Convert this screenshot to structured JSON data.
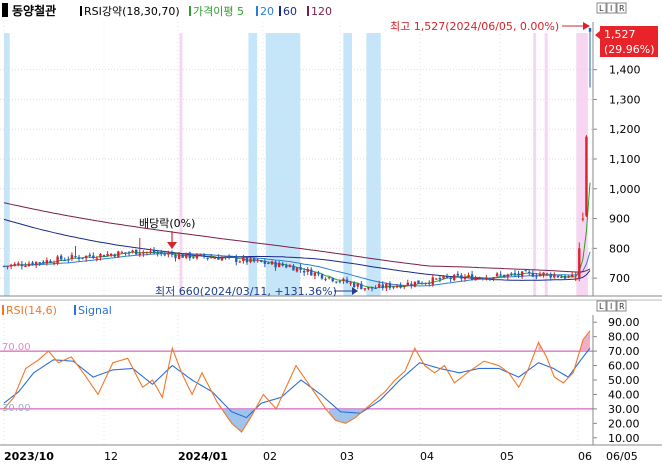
{
  "header": {
    "stock_name": "동양철관",
    "legend": [
      {
        "label": "RSI강약(18,30,70)",
        "color": "#000000",
        "marker": "#000000"
      },
      {
        "label": "가격이평 5",
        "color": "#2e9e2e",
        "marker": "#2e9e2e"
      },
      {
        "label": "20",
        "color": "#2a7fd4",
        "marker": "#2a7fd4"
      },
      {
        "label": "60",
        "color": "#1a2a8a",
        "marker": "#1a2a8a"
      },
      {
        "label": "120",
        "color": "#7a1f4a",
        "marker": "#7a1f4a"
      }
    ],
    "panel_buttons": [
      "L",
      "I",
      "R"
    ]
  },
  "annotations": {
    "high": "최고 1,527(2024/06/05, 0.00%)",
    "low": "최저 660(2024/03/11, +131.36%)",
    "dividend": "배당락(0%)",
    "current_price": "1,527",
    "current_change": "(29.96%)"
  },
  "lower_header": {
    "rsi_label": "RSI(14,6)",
    "signal_label": "Signal",
    "level_70": "70.00",
    "level_30": "30.00"
  },
  "colors": {
    "up": "#d8232a",
    "down": "#1f5fbf",
    "rsi": "#f07828",
    "signal": "#2d6fd6",
    "band_blue": "#c5e5f8",
    "band_pink": "#f8d5f2",
    "level_line": "#d040b0",
    "price_label_bg": "#e8242a"
  },
  "chart_data": [
    {
      "type": "candlestick",
      "title": "동양철관",
      "x_labels": [
        "2023/10",
        "12",
        "2024/01",
        "02",
        "03",
        "04",
        "05",
        "06"
      ],
      "ylim": [
        640,
        1560
      ],
      "y_ticks": [
        700,
        800,
        900,
        1000,
        1100,
        1200,
        1300,
        1400,
        1527
      ],
      "close_series_key": [
        [
          "2023/10 start",
          740
        ],
        [
          "2023/11 mid",
          770
        ],
        [
          "2023/12 early",
          790
        ],
        [
          "2023/12 dividend",
          775
        ],
        [
          "2024/01",
          770
        ],
        [
          "2024/02",
          740
        ],
        [
          "2024/03/11",
          665
        ],
        [
          "2024/04",
          700
        ],
        [
          "2024/05",
          715
        ],
        [
          "2024/05 late",
          700
        ],
        [
          "2024/06/03",
          900
        ],
        [
          "2024/06/04",
          1175
        ],
        [
          "2024/06/05",
          1527
        ]
      ],
      "moving_averages": [
        {
          "name": "5",
          "color": "#2e9e2e"
        },
        {
          "name": "20",
          "color": "#2a7fd4"
        },
        {
          "name": "60",
          "color": "#1a2a8a"
        },
        {
          "name": "120",
          "color": "#7a1f4a"
        }
      ],
      "high": {
        "value": 1527,
        "date": "2024/06/05"
      },
      "low": {
        "value": 660,
        "date": "2024/03/11"
      }
    },
    {
      "type": "line",
      "series": [
        {
          "name": "RSI(14,6)",
          "color": "#f07828"
        },
        {
          "name": "Signal",
          "color": "#2d6fd6"
        }
      ],
      "ylim": [
        5,
        95
      ],
      "y_ticks": [
        10,
        20,
        30,
        40,
        50,
        60,
        70,
        80,
        90
      ],
      "y_tick_labels": [
        "10.00",
        "20.00",
        "30.00",
        "40.00",
        "50.00",
        "60.00",
        "70.00",
        "80.00",
        "90.00"
      ],
      "levels": [
        70,
        30
      ],
      "x_labels": [
        "2023/10",
        "12",
        "2024/01",
        "02",
        "03",
        "04",
        "05",
        "06"
      ],
      "last_x_label": "06/05",
      "rsi_keypoints": [
        [
          0,
          30
        ],
        [
          10,
          38
        ],
        [
          22,
          58
        ],
        [
          35,
          64
        ],
        [
          45,
          70
        ],
        [
          55,
          62
        ],
        [
          68,
          66
        ],
        [
          80,
          55
        ],
        [
          95,
          40
        ],
        [
          110,
          62
        ],
        [
          125,
          65
        ],
        [
          140,
          45
        ],
        [
          150,
          50
        ],
        [
          160,
          38
        ],
        [
          170,
          72
        ],
        [
          180,
          54
        ],
        [
          190,
          40
        ],
        [
          200,
          55
        ],
        [
          215,
          35
        ],
        [
          230,
          20
        ],
        [
          240,
          14
        ],
        [
          250,
          25
        ],
        [
          262,
          40
        ],
        [
          275,
          30
        ],
        [
          285,
          45
        ],
        [
          295,
          60
        ],
        [
          305,
          50
        ],
        [
          315,
          40
        ],
        [
          325,
          30
        ],
        [
          335,
          22
        ],
        [
          345,
          20
        ],
        [
          355,
          24
        ],
        [
          370,
          33
        ],
        [
          385,
          42
        ],
        [
          395,
          50
        ],
        [
          405,
          56
        ],
        [
          415,
          72
        ],
        [
          425,
          60
        ],
        [
          435,
          55
        ],
        [
          445,
          60
        ],
        [
          455,
          48
        ],
        [
          470,
          56
        ],
        [
          485,
          63
        ],
        [
          500,
          60
        ],
        [
          510,
          55
        ],
        [
          520,
          45
        ],
        [
          530,
          58
        ],
        [
          540,
          76
        ],
        [
          548,
          66
        ],
        [
          556,
          52
        ],
        [
          565,
          48
        ],
        [
          575,
          55
        ],
        [
          585,
          78
        ],
        [
          592,
          84
        ]
      ],
      "signal_keypoints": [
        [
          0,
          34
        ],
        [
          15,
          42
        ],
        [
          30,
          55
        ],
        [
          50,
          64
        ],
        [
          70,
          63
        ],
        [
          90,
          52
        ],
        [
          110,
          57
        ],
        [
          130,
          58
        ],
        [
          150,
          47
        ],
        [
          170,
          60
        ],
        [
          190,
          50
        ],
        [
          210,
          42
        ],
        [
          230,
          28
        ],
        [
          245,
          24
        ],
        [
          260,
          34
        ],
        [
          280,
          38
        ],
        [
          300,
          50
        ],
        [
          320,
          40
        ],
        [
          340,
          28
        ],
        [
          360,
          27
        ],
        [
          380,
          36
        ],
        [
          400,
          50
        ],
        [
          420,
          62
        ],
        [
          440,
          58
        ],
        [
          460,
          55
        ],
        [
          480,
          58
        ],
        [
          500,
          58
        ],
        [
          520,
          52
        ],
        [
          540,
          62
        ],
        [
          555,
          58
        ],
        [
          570,
          52
        ],
        [
          585,
          66
        ],
        [
          592,
          72
        ]
      ]
    }
  ]
}
